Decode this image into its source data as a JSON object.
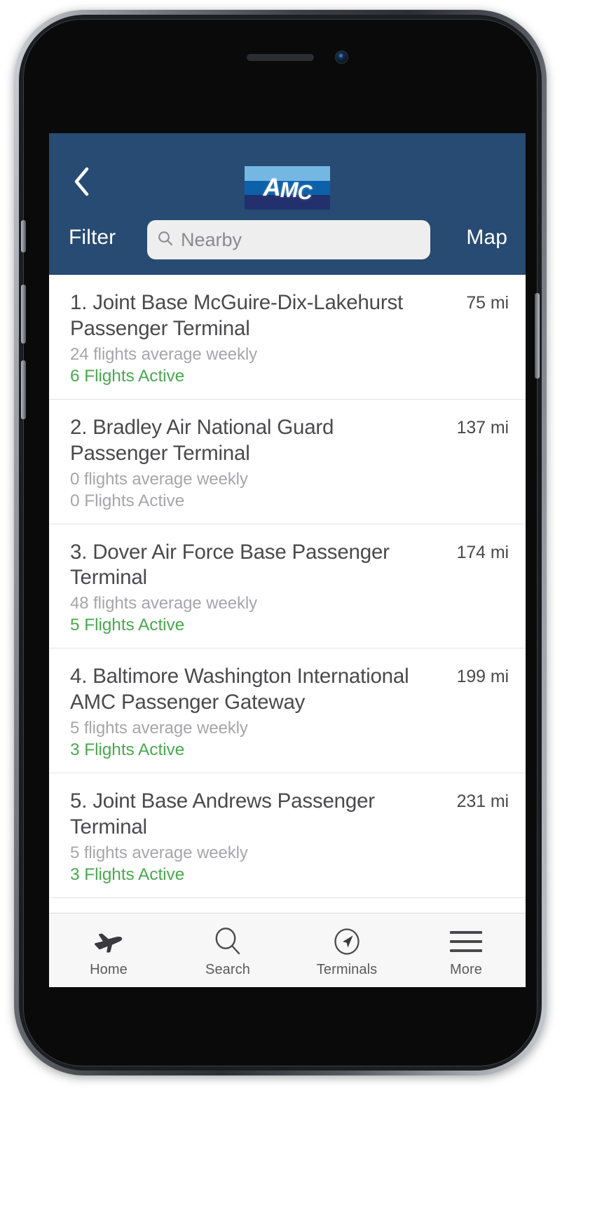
{
  "app": {
    "logo": {
      "name": "amc-logo",
      "letters": [
        "A",
        "M",
        "C"
      ],
      "band_colors": [
        "#74b7e3",
        "#0d61a8",
        "#22306e"
      ]
    },
    "header_bg": "#274B72"
  },
  "topbar": {
    "back_icon": "chevron-left-icon",
    "filter_label": "Filter",
    "map_label": "Map",
    "search": {
      "icon": "search-icon",
      "value": "",
      "placeholder": "Nearby"
    }
  },
  "colors": {
    "accent_active": "#4aa84f",
    "muted": "#a6a6a9",
    "text": "#4a4a4c"
  },
  "list": {
    "items": [
      {
        "title": "1. Joint Base McGuire-Dix-Lakehurst Passenger Terminal",
        "distance": "75 mi",
        "subtitle": "24 flights average weekly",
        "status": "6 Flights Active",
        "status_state": "active"
      },
      {
        "title": "2. Bradley Air National Guard Passenger Terminal",
        "distance": "137 mi",
        "subtitle": "0 flights average weekly",
        "status": "0 Flights Active",
        "status_state": "inactive"
      },
      {
        "title": "3. Dover Air Force Base Passenger Terminal",
        "distance": "174 mi",
        "subtitle": "48 flights average weekly",
        "status": "5 Flights Active",
        "status_state": "active"
      },
      {
        "title": "4. Baltimore Washington International AMC Passenger Gateway",
        "distance": "199 mi",
        "subtitle": "5 flights average weekly",
        "status": "3 Flights Active",
        "status_state": "active"
      },
      {
        "title": "5. Joint Base Andrews Passenger Terminal",
        "distance": "231 mi",
        "subtitle": "5 flights average weekly",
        "status": "3 Flights Active",
        "status_state": "active"
      }
    ]
  },
  "tabbar": {
    "tabs": [
      {
        "label": "Home",
        "icon": "airplane-icon"
      },
      {
        "label": "Search",
        "icon": "search-icon"
      },
      {
        "label": "Terminals",
        "icon": "navigation-compass-icon"
      },
      {
        "label": "More",
        "icon": "hamburger-menu-icon"
      }
    ]
  }
}
